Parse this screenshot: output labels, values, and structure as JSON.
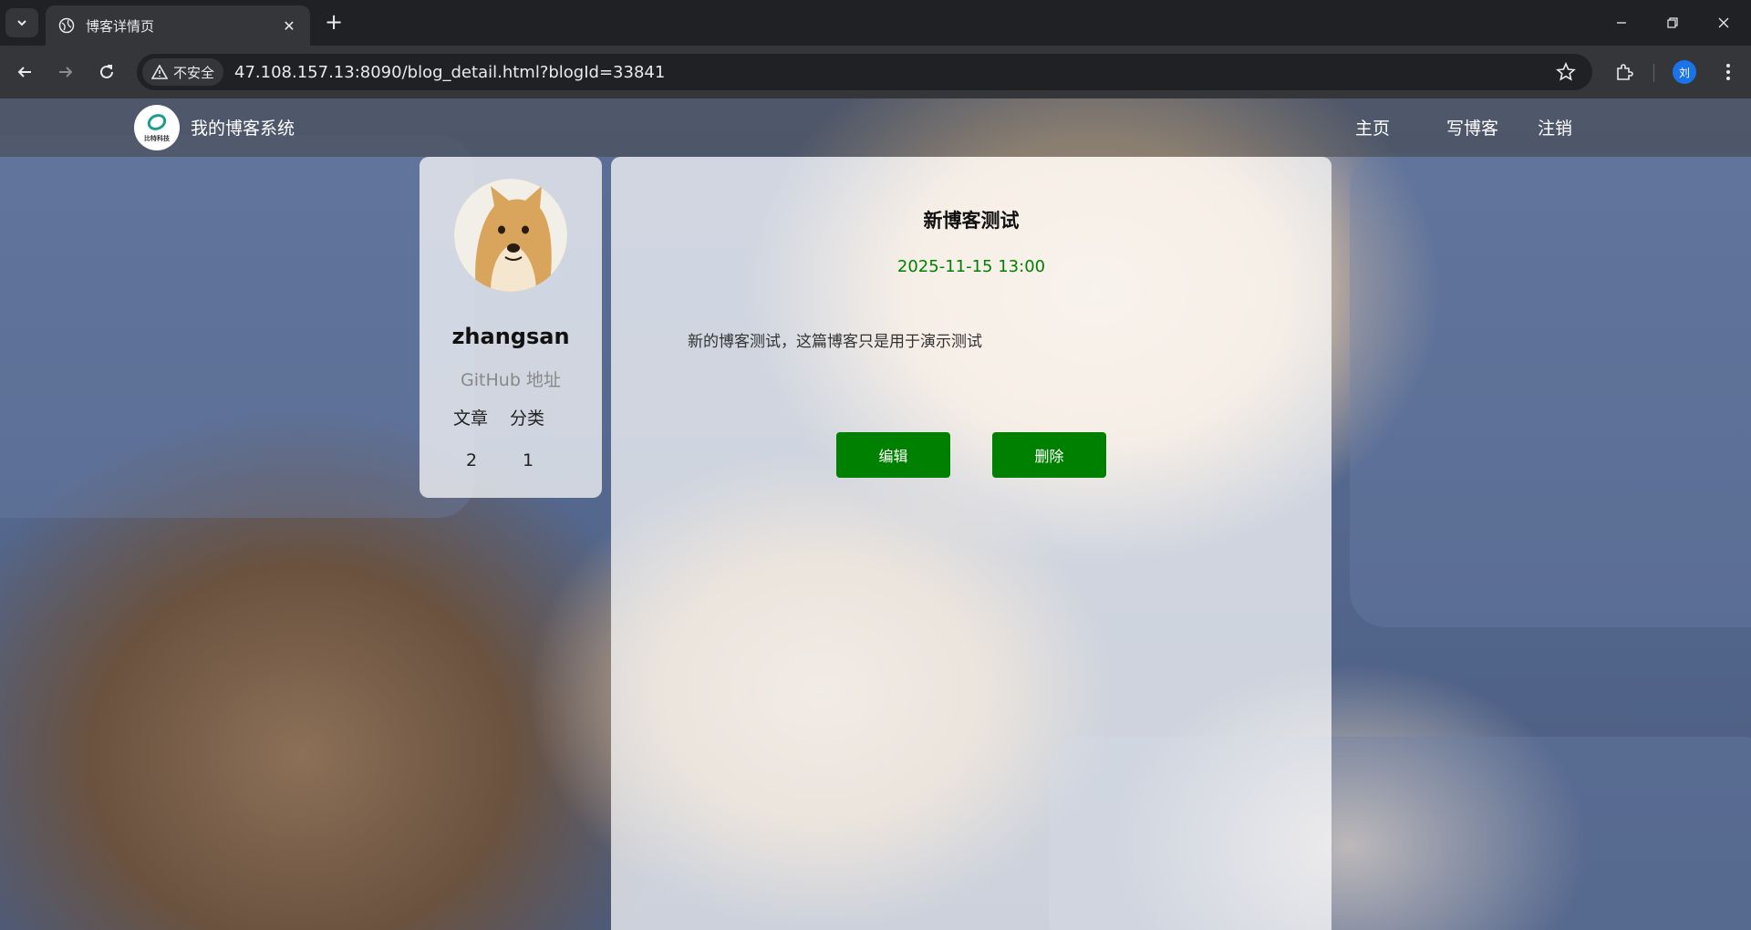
{
  "browser": {
    "tab_title": "博客详情页",
    "security_label": "不安全",
    "url": "47.108.157.13:8090/blog_detail.html?blogId=33841",
    "profile_initial": "刘"
  },
  "site": {
    "logo_text": "比特科技",
    "title": "我的博客系统",
    "nav": {
      "home": "主页",
      "write": "写博客",
      "logout": "注销"
    }
  },
  "user": {
    "name": "zhangsan",
    "github_link": "GitHub 地址",
    "stats": {
      "articles_label": "文章",
      "categories_label": "分类",
      "articles_count": "2",
      "categories_count": "1"
    }
  },
  "blog": {
    "title": "新博客测试",
    "date": "2025-11-15 13:00",
    "content": "新的博客测试，这篇博客只是用于演示测试",
    "edit_label": "编辑",
    "delete_label": "删除"
  },
  "colors": {
    "accent_green": "#008000",
    "date_green": "#008000"
  }
}
